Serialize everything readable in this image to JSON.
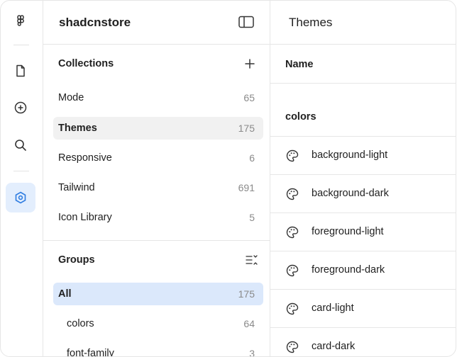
{
  "rail": {
    "icons": [
      "figma-icon",
      "file-icon",
      "plus-circle-icon",
      "search-icon",
      "variables-icon"
    ]
  },
  "panel": {
    "app_title": "shadcnstore",
    "collections_title": "Collections",
    "collections": [
      {
        "label": "Mode",
        "count": "65"
      },
      {
        "label": "Themes",
        "count": "175",
        "selected": true
      },
      {
        "label": "Responsive",
        "count": "6"
      },
      {
        "label": "Tailwind",
        "count": "691"
      },
      {
        "label": "Icon Library",
        "count": "5"
      }
    ],
    "groups_title": "Groups",
    "groups": [
      {
        "label": "All",
        "count": "175",
        "selected": true
      },
      {
        "label": "colors",
        "count": "64"
      },
      {
        "label": "font-family",
        "count": "3"
      }
    ]
  },
  "content": {
    "title": "Themes",
    "column_name": "Name",
    "group_label": "colors",
    "variables": [
      "background-light",
      "background-dark",
      "foreground-light",
      "foreground-dark",
      "card-light",
      "card-dark"
    ]
  },
  "colors": {
    "accent": "#2f7de1",
    "selected_bg": "#f1f1f1",
    "active_bg": "#dbe8fb"
  }
}
